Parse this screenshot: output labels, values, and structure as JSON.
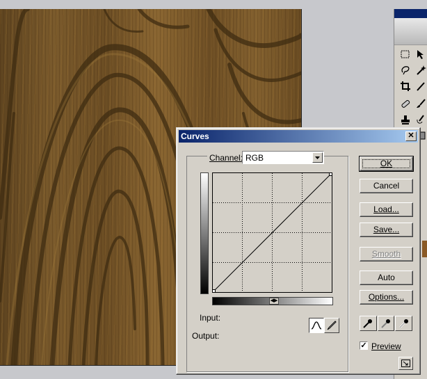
{
  "dialog": {
    "title": "Curves",
    "close_glyph": "✕",
    "channel_label": "Channel:",
    "channel_value": "RGB",
    "input_label": "Input:",
    "output_label": "Output:",
    "buttons": {
      "ok": "OK",
      "cancel": "Cancel",
      "load": "Load...",
      "save": "Save...",
      "smooth": "Smooth",
      "auto": "Auto",
      "options": "Options..."
    },
    "preview_label": "Preview",
    "preview_checked": true,
    "preview_glyph": "✓",
    "swap_glyph": "◀▶",
    "icons": {
      "curve_tool": "curve-icon",
      "pencil_tool": "pencil-icon",
      "black_eyedropper": "eyedropper-black-icon",
      "gray_eyedropper": "eyedropper-gray-icon",
      "white_eyedropper": "eyedropper-white-icon",
      "resize": "expand-icon"
    }
  },
  "curve": {
    "points": [
      [
        0,
        0
      ],
      [
        255,
        255
      ]
    ]
  },
  "colors": {
    "titlebar_start": "#0a246a",
    "titlebar_end": "#a6caf0",
    "dialog_face": "#d4d0c8",
    "wood_dark": "#4a3416",
    "wood_light": "#8a6632"
  }
}
